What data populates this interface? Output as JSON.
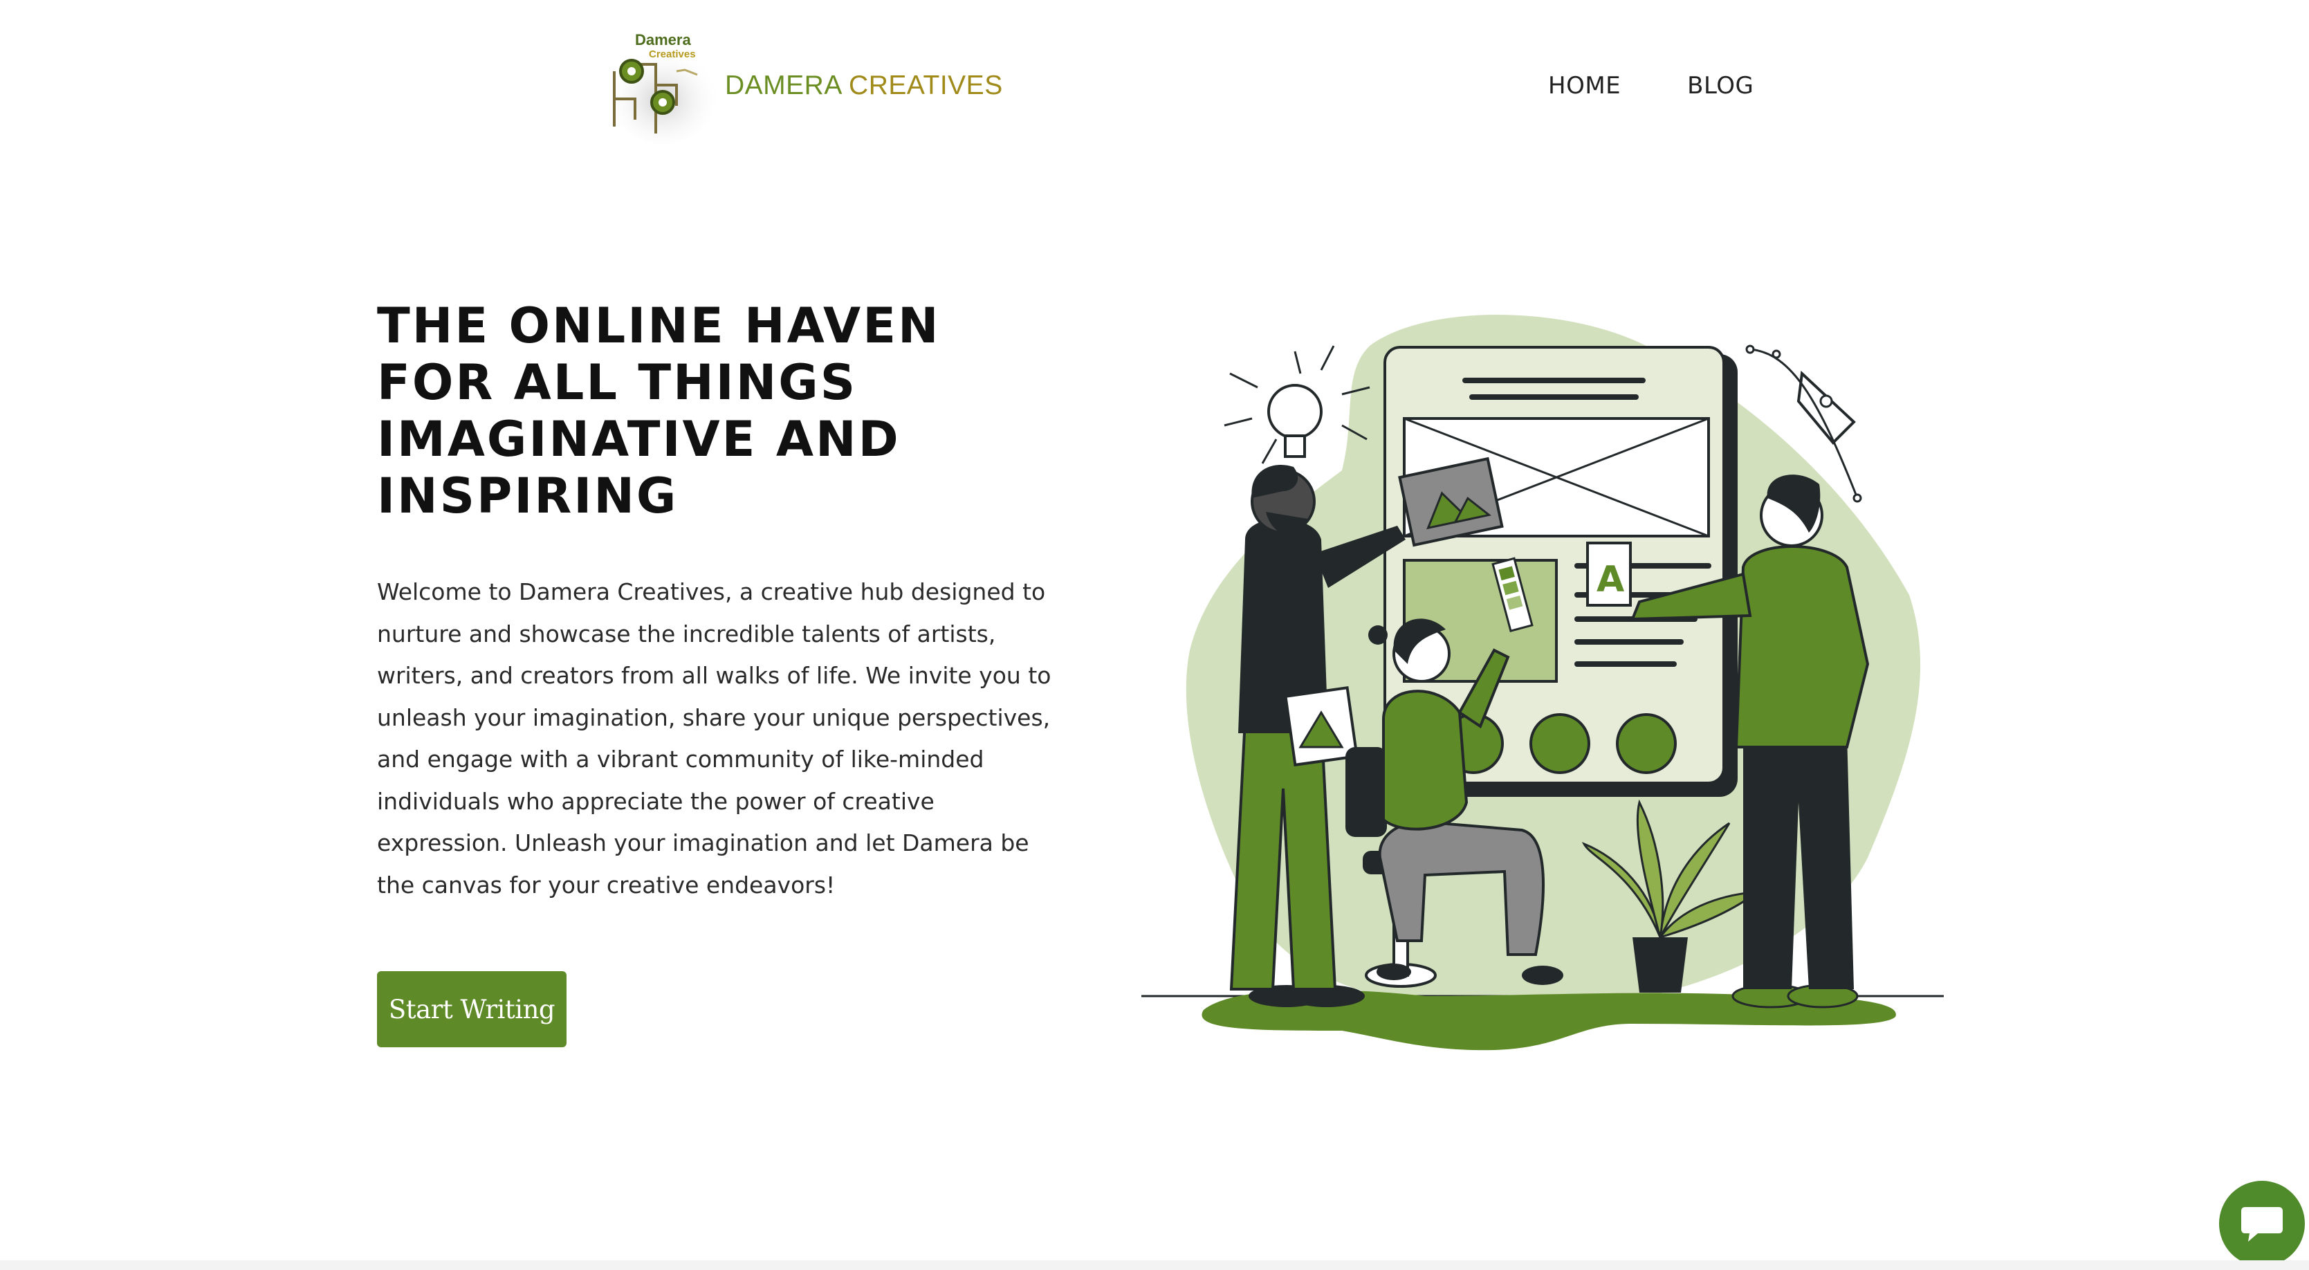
{
  "header": {
    "logo_small_top": "Damera",
    "logo_small_bottom": "Creatives",
    "brand_word1": "DAMERA",
    "brand_word2": "CREATIVES",
    "nav": [
      {
        "label": "HOME"
      },
      {
        "label": "BLOG"
      }
    ]
  },
  "hero": {
    "title": "THE ONLINE HAVEN FOR ALL THINGS IMAGINATIVE AND INSPIRING",
    "body": "Welcome to Damera Creatives, a creative hub designed to nurture and showcase the incredible talents of artists, writers, and creators from all walks of life. We invite you to unleash your imagination, share your unique perspectives, and engage with a vibrant community of like-minded individuals who appreciate the power of creative expression. Unleash your imagination and let Damera be the canvas for your creative endeavors!",
    "cta_label": "Start Writing"
  },
  "colors": {
    "accent": "#5f8a28",
    "accent_light": "#d3e0bd",
    "brand_green": "#6b8e23",
    "brand_gold": "#a08a1a",
    "dark": "#23292b"
  },
  "icons": {
    "chat": "chat-bubble-icon",
    "lightbulb": "lightbulb-icon",
    "pen": "pen-tool-icon"
  }
}
